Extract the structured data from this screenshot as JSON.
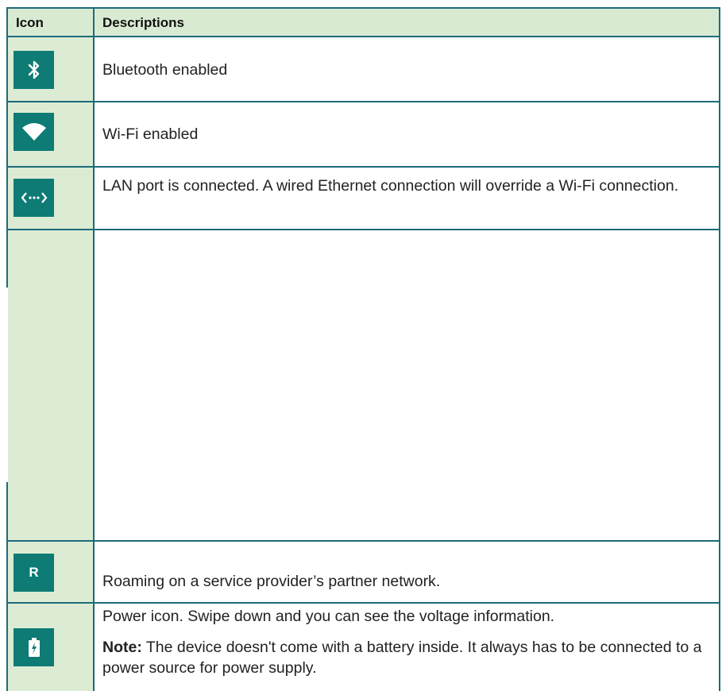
{
  "header": {
    "icon_label": "Icon",
    "desc_label": "Descriptions"
  },
  "rows": [
    {
      "icon": "bluetooth-icon",
      "text": "Bluetooth enabled"
    },
    {
      "icon": "wifi-icon",
      "text": "Wi-Fi enabled"
    },
    {
      "icon": "ethernet-icon",
      "text": "LAN port is connected. A wired Ethernet connection will override a Wi-Fi connection."
    },
    {
      "icon": "",
      "text": ""
    },
    {
      "icon": "roaming-icon",
      "icon_text": "R",
      "text": "Roaming on a service provider’s partner network."
    },
    {
      "icon": "power-icon",
      "text": "Power icon. Swipe down and you can see the voltage information.",
      "note_label": "Note:",
      "note_text": " The device doesn't come with a battery inside. It always has to be connected to a power source for power supply."
    }
  ],
  "colors": {
    "border": "#1d6b7a",
    "header_bg": "#d9ead3",
    "icon_bg": "#0e7b75"
  }
}
